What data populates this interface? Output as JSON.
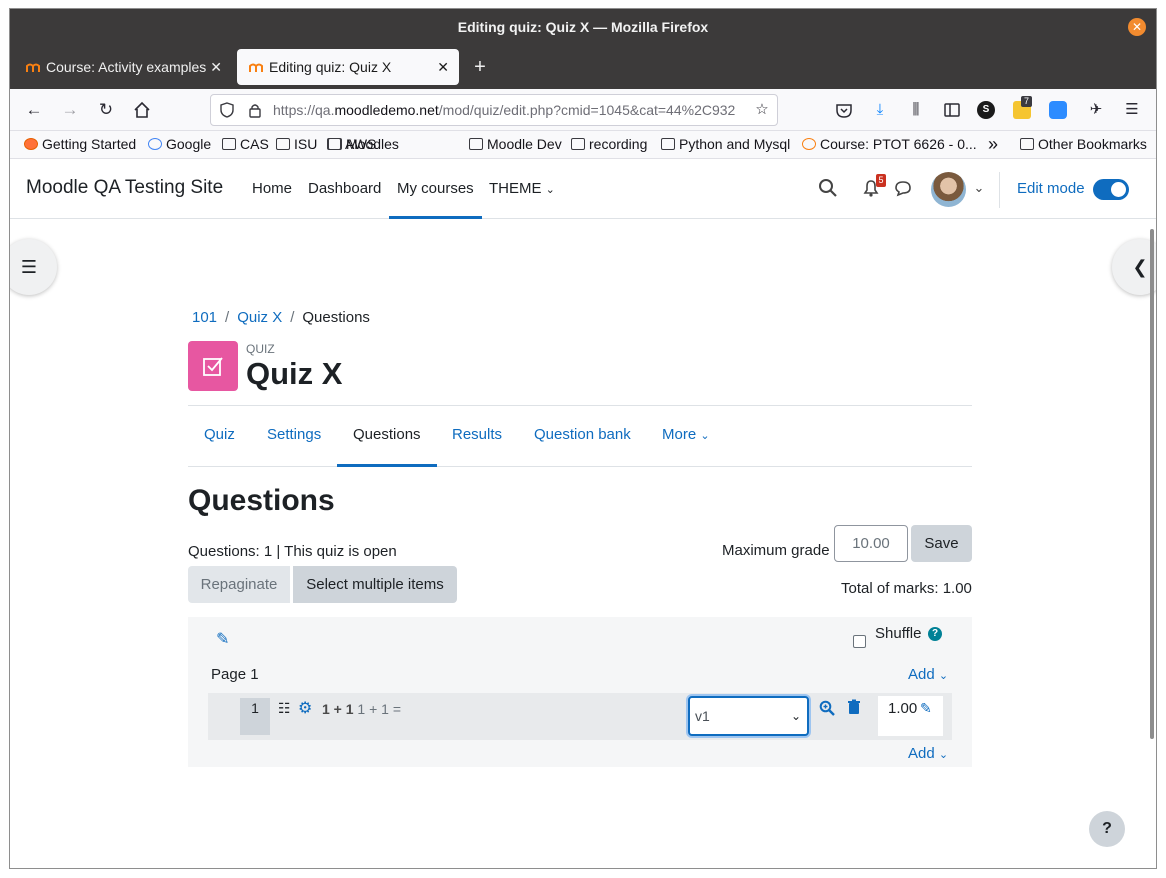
{
  "window": {
    "title": "Editing quiz: Quiz X — Mozilla Firefox"
  },
  "tabs": [
    {
      "label": "Course: Activity examples"
    },
    {
      "label": "Editing quiz: Quiz X"
    }
  ],
  "urlbar": {
    "prefix": "https://qa.",
    "domain": "moodledemo.net",
    "path": "/mod/quiz/edit.php?cmid=1045&cat=44%2C932"
  },
  "toolbar": {
    "extension_badge": "7"
  },
  "bookmarks": [
    "Getting Started",
    "Google",
    "CAS",
    "ISU",
    "AWS",
    "Moodles",
    "Moodle Dev",
    "recording",
    "Python and Mysql",
    "Course: PTOT 6626 - 0...",
    "Other Bookmarks"
  ],
  "moodle": {
    "site_name": "Moodle QA Testing Site",
    "nav": [
      "Home",
      "Dashboard",
      "My courses",
      "THEME"
    ],
    "notification_count": "5",
    "edit_mode_label": "Edit mode"
  },
  "breadcrumb": {
    "items": [
      "101",
      "Quiz X"
    ],
    "current": "Questions"
  },
  "header": {
    "label": "QUIZ",
    "title": "Quiz X"
  },
  "secondary_nav": [
    "Quiz",
    "Settings",
    "Questions",
    "Results",
    "Question bank",
    "More"
  ],
  "questions": {
    "heading": "Questions",
    "info": "Questions: 1 | This quiz is open",
    "max_grade_label": "Maximum grade",
    "max_grade_value": "10.00",
    "save_label": "Save",
    "repaginate_label": "Repaginate",
    "select_multiple_label": "Select multiple items",
    "total_marks": "Total of marks: 1.00",
    "shuffle_label": "Shuffle",
    "page_label": "Page 1",
    "add_label": "Add",
    "row": {
      "number": "1",
      "name": "1 + 1",
      "text": "1 + 1 =",
      "version": "v1",
      "mark": "1.00"
    }
  },
  "help_button": "?"
}
